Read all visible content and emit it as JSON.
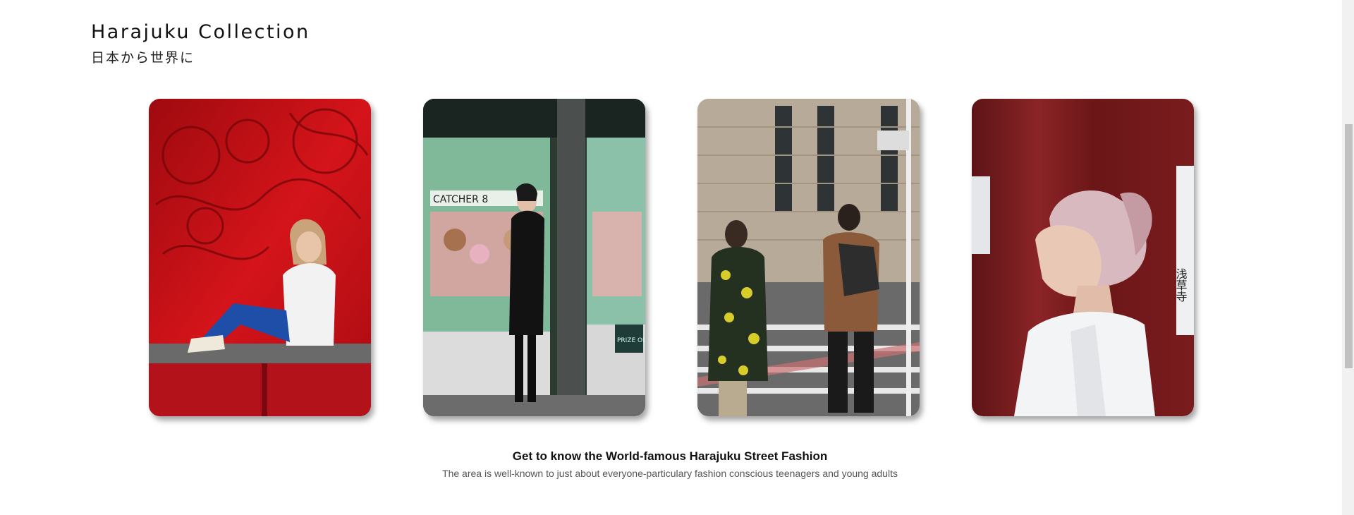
{
  "header": {
    "title": "Harajuku Collection",
    "subtitle": "日本から世界に"
  },
  "gallery": {
    "images": [
      {
        "icon": "photo-woman-red-wall"
      },
      {
        "icon": "photo-woman-arcade"
      },
      {
        "icon": "photo-people-street-crossing"
      },
      {
        "icon": "photo-man-pink-hair-red-pillar"
      }
    ],
    "sign_text_1": "CATCHER 8",
    "sign_text_2": "PRIZE OUT",
    "sign_text_3": "浅草寺"
  },
  "caption": {
    "title": "Get to know the World-famous Harajuku Street Fashion",
    "text": "The area is well-known to just about everyone-particulary fashion conscious teenagers and young adults"
  },
  "colors": {
    "background": "#ffffff",
    "text": "#111111",
    "muted": "#555555"
  }
}
